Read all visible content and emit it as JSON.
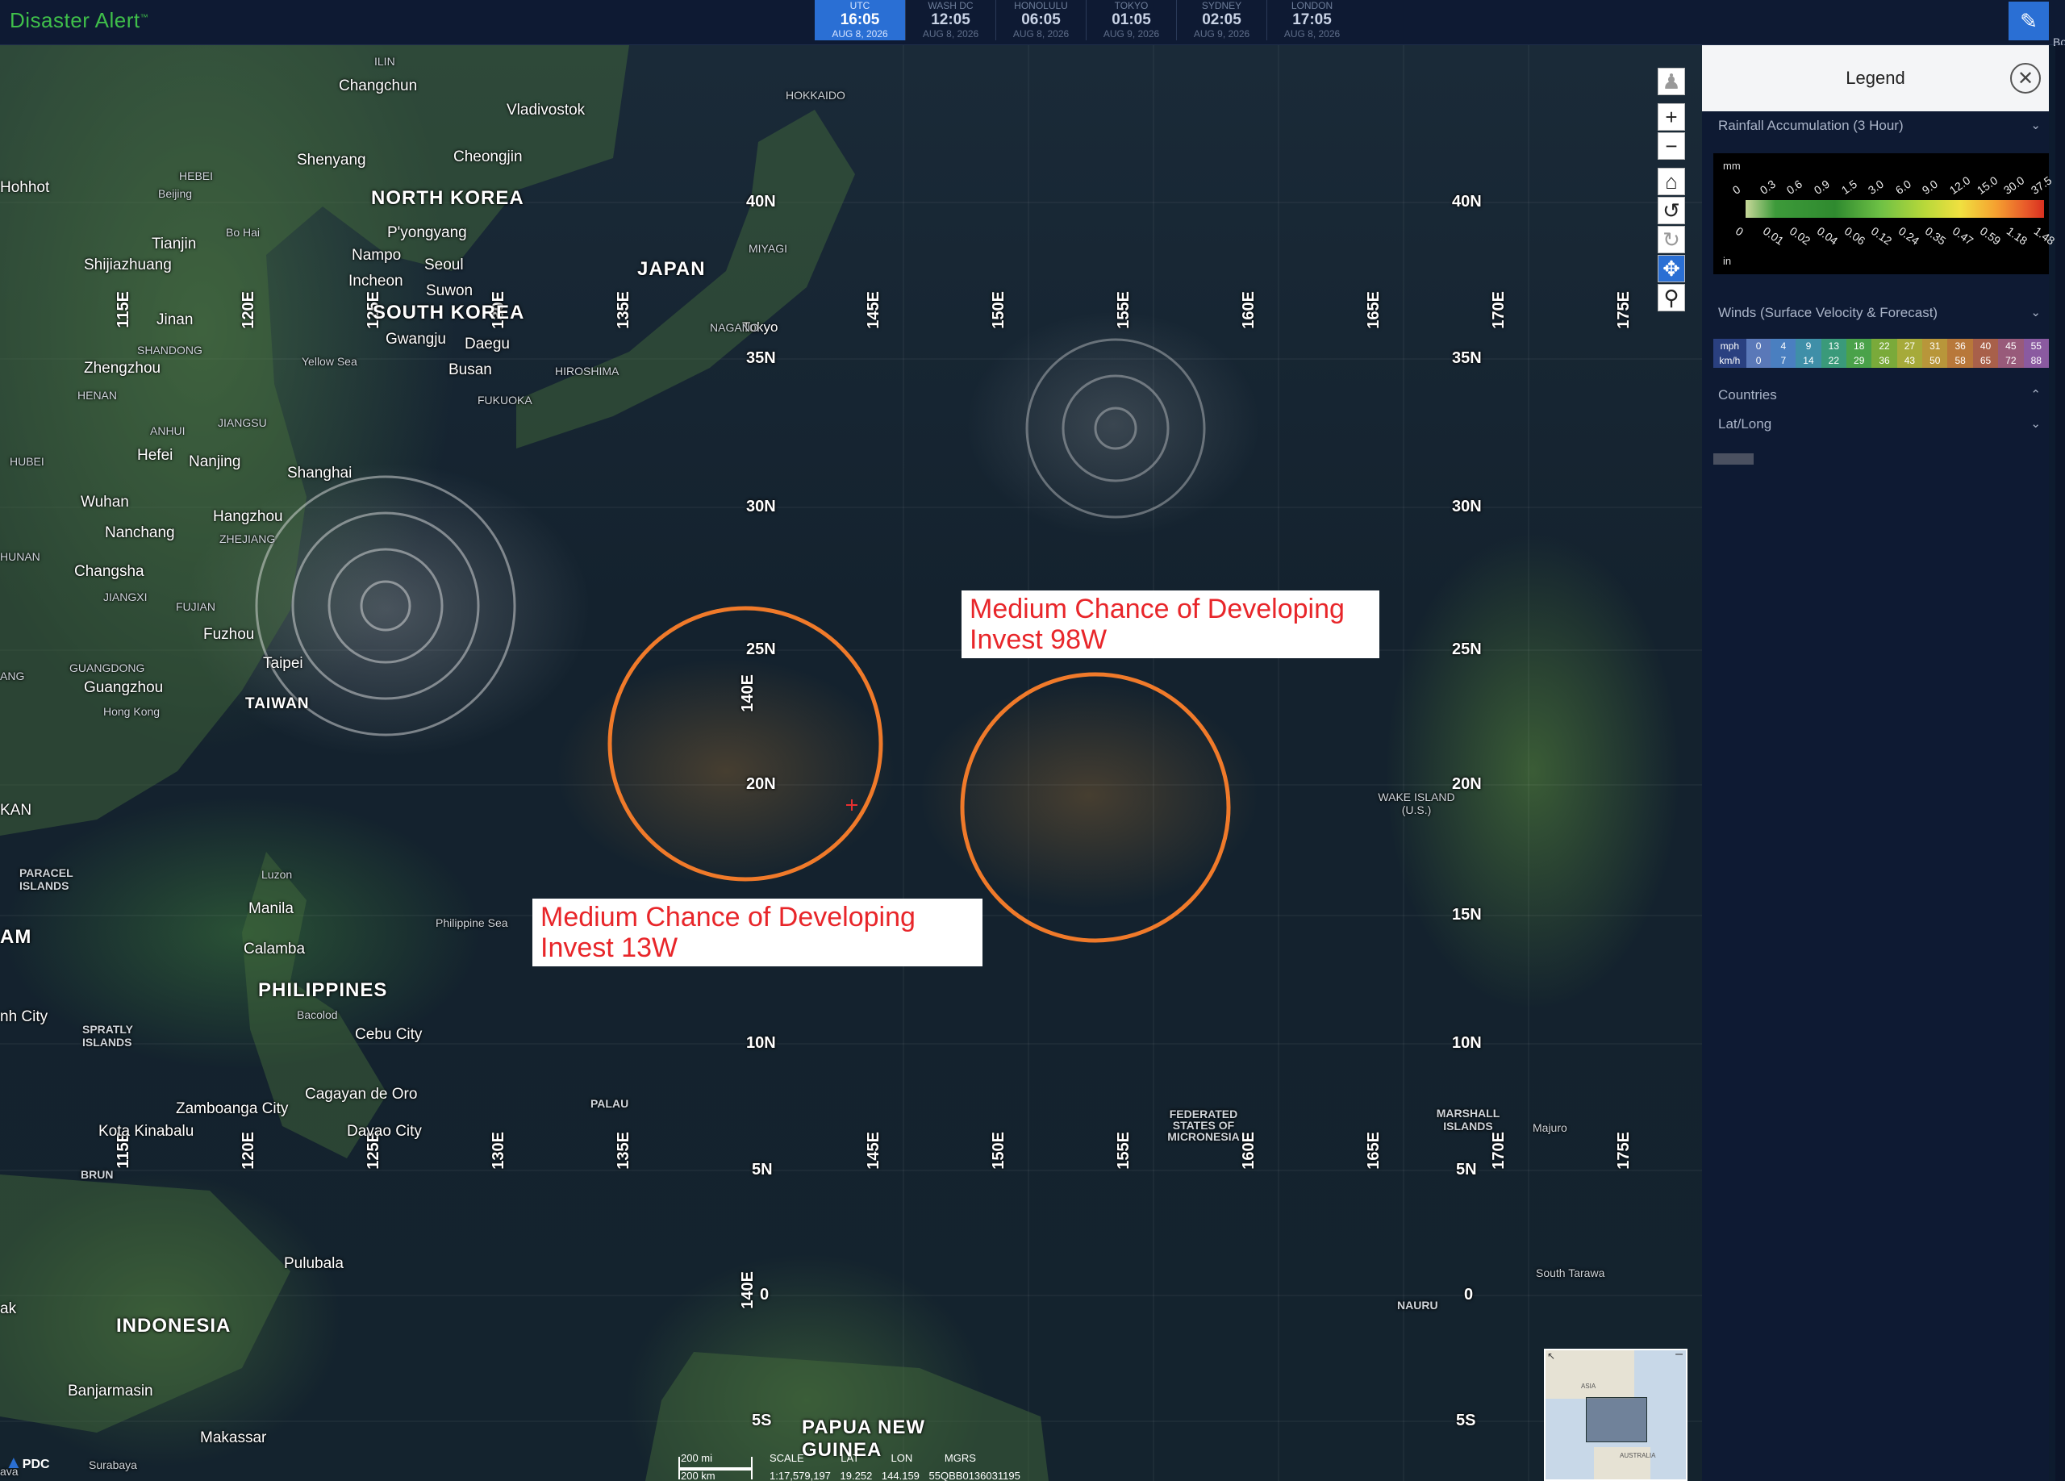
{
  "app": {
    "title": "Disaster Alert",
    "tm": "™"
  },
  "clocks": [
    {
      "city": "UTC",
      "time": "16:05",
      "date": "AUG 8, 2026",
      "active": true
    },
    {
      "city": "WASH DC",
      "time": "12:05",
      "date": "AUG 8, 2026"
    },
    {
      "city": "HONOLULU",
      "time": "06:05",
      "date": "AUG 8, 2026"
    },
    {
      "city": "TOKYO",
      "time": "01:05",
      "date": "AUG 9, 2026"
    },
    {
      "city": "SYDNEY",
      "time": "02:05",
      "date": "AUG 9, 2026"
    },
    {
      "city": "LONDON",
      "time": "17:05",
      "date": "AUG 8, 2026"
    }
  ],
  "edge_text": "Bo",
  "annotations": {
    "invest_98w": {
      "line1": "Medium Chance of Developing",
      "line2": "Invest 98W"
    },
    "invest_13w": {
      "line1": "Medium Chance of Developing",
      "line2": "Invest 13W"
    }
  },
  "map_labels": {
    "countries": [
      "NORTH KOREA",
      "SOUTH KOREA",
      "JAPAN",
      "TAIWAN",
      "PHILIPPINES",
      "INDONESIA",
      "PAPUA NEW GUINEA"
    ],
    "cities": [
      "Changchun",
      "Vladivostok",
      "Shenyang",
      "Cheongjin",
      "Beijing",
      "Tianjin",
      "Shijiazhuang",
      "P'yongyang",
      "Nampo",
      "Seoul",
      "Incheon",
      "Suwon",
      "Jinan",
      "Gwangju",
      "Daegu",
      "Busan",
      "Tokyo",
      "Zhengzhou",
      "Hefei",
      "Nanjing",
      "Shanghai",
      "Wuhan",
      "Hangzhou",
      "Nanchang",
      "Changsha",
      "Fuzhou",
      "Taipei",
      "Guangzhou",
      "Hong Kong",
      "Manila",
      "Calamba",
      "Cebu City",
      "Zamboanga City",
      "Cagayan de Oro",
      "Davao City",
      "Kota Kinabalu",
      "Pulubala",
      "Makassar",
      "Banjarmasin",
      "Majuro",
      "South Tarawa",
      "Bacolod",
      "Luzon",
      "Hohhot",
      "Surabaya"
    ],
    "small": [
      "HOKKAIDO",
      "MIYAGI",
      "NAGANO",
      "HIROSHIMA",
      "FUKUOKA",
      "HEBEI",
      "SHANDONG",
      "HENAN",
      "ANHUI",
      "JIANGSU",
      "HUBEI",
      "HUNAN",
      "JIANGXI",
      "FUJIAN",
      "GUANGDONG",
      "ZHEJIANG",
      "Yellow Sea",
      "Bo Hai",
      "Philippine Sea",
      "PARACEL ISLANDS",
      "SPRATLY ISLANDS",
      "PALAU",
      "WAKE ISLAND (U.S.)",
      "FEDERATED STATES OF MICRONESIA",
      "MARSHALL ISLANDS",
      "NAURU",
      "KAN",
      "ANG",
      "ILIN",
      "AM",
      "nh City",
      "BRUN",
      "ak",
      "ava",
      "AUSTRALIA",
      "ASIA"
    ],
    "latitudes": [
      "40N",
      "35N",
      "30N",
      "25N",
      "20N",
      "15N",
      "10N",
      "5N",
      "0",
      "5S"
    ],
    "longitudes": [
      "115E",
      "120E",
      "125E",
      "130E",
      "135E",
      "140E",
      "145E",
      "150E",
      "155E",
      "160E",
      "165E",
      "170E",
      "175E"
    ]
  },
  "legend": {
    "title": "Legend",
    "rainfall": {
      "title": "Rainfall Accumulation (3 Hour)",
      "unit_top": "mm",
      "unit_bottom": "in",
      "mm_ticks": [
        "0",
        "0.3",
        "0.6",
        "0.9",
        "1.5",
        "3.0",
        "6.0",
        "9.0",
        "12.0",
        "15.0",
        "30.0",
        "37.5"
      ],
      "in_ticks": [
        "0",
        "0.01",
        "0.02",
        "0.04",
        "0.06",
        "0.12",
        "0.24",
        "0.35",
        "0.47",
        "0.59",
        "1.18",
        "1.48"
      ]
    },
    "winds": {
      "title": "Winds (Surface Velocity & Forecast)",
      "mph_label": "mph",
      "kmh_label": "km/h",
      "mph": [
        "0",
        "4",
        "9",
        "13",
        "18",
        "22",
        "27",
        "31",
        "36",
        "40",
        "45",
        "55"
      ],
      "kmh": [
        "0",
        "7",
        "14",
        "22",
        "29",
        "36",
        "43",
        "50",
        "58",
        "65",
        "72",
        "88"
      ],
      "colors": [
        "#5a78b8",
        "#4a7fc0",
        "#3f8fa8",
        "#3a9a7a",
        "#4aa24a",
        "#7aaa3a",
        "#a6aa3a",
        "#b8963a",
        "#b8783a",
        "#a8604a",
        "#985a7a",
        "#8a5aa0"
      ]
    },
    "countries_label": "Countries",
    "latlong_label": "Lat/Long"
  },
  "scale": {
    "mi": "200 mi",
    "km": "200 km",
    "scale_label": "SCALE",
    "lat_label": "LAT",
    "lon_label": "LON",
    "mgrs_label": "MGRS",
    "scale_value": "1:17,579,197",
    "lat_value": "19.252",
    "lon_value": "144.159",
    "mgrs_value": "55QBB0136031195"
  },
  "logo": "PDC",
  "colors": {
    "accent": "#2a6fd4",
    "brand": "#3fbf4a",
    "annotation_text": "#e8262a",
    "circle": "#f07a2a"
  }
}
